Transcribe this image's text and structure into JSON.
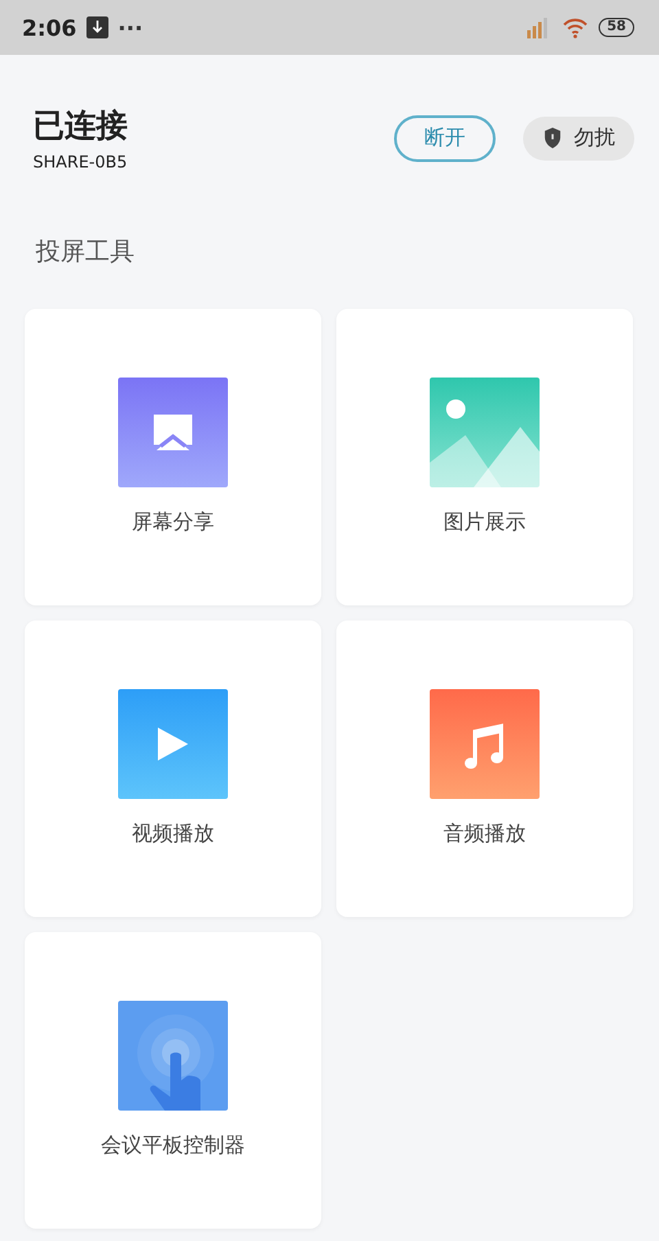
{
  "status_bar": {
    "time": "2:06",
    "more": "···",
    "battery": "58"
  },
  "header": {
    "title": "已连接",
    "device": "SHARE-0B5",
    "disconnect_button": "断开",
    "dnd_button": "勿扰"
  },
  "section_title": "投屏工具",
  "tools": [
    {
      "kind": "screen",
      "label": "屏幕分享"
    },
    {
      "kind": "image",
      "label": "图片展示"
    },
    {
      "kind": "video",
      "label": "视频播放"
    },
    {
      "kind": "audio",
      "label": "音频播放"
    },
    {
      "kind": "touch",
      "label": "会议平板控制器"
    }
  ]
}
